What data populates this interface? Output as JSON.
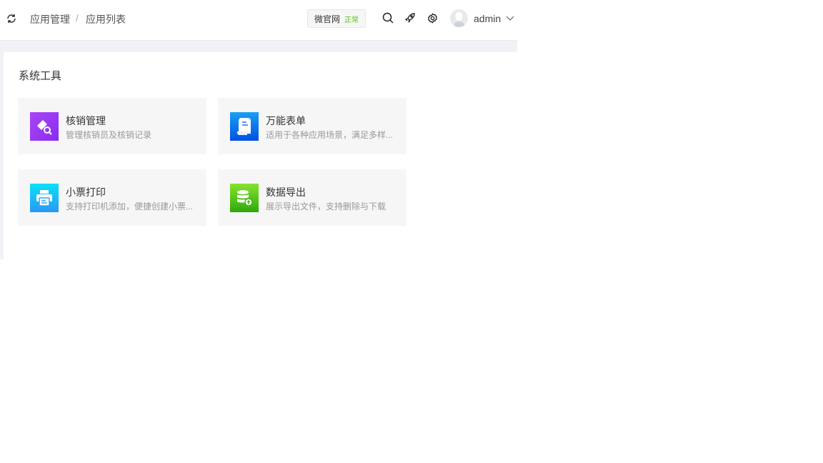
{
  "header": {
    "breadcrumb": [
      "应用管理",
      "应用列表"
    ],
    "separator": "/",
    "site_name": "微官网",
    "site_status": "正常",
    "user": "admin"
  },
  "section_title": "系统工具",
  "apps": [
    {
      "title": "核销管理",
      "desc": "管理核销员及核销记录",
      "color": "#9b3cf7"
    },
    {
      "title": "万能表单",
      "desc": "适用于各种应用场景，满足多样...",
      "color": "#1a73f0"
    },
    {
      "title": "小票打印",
      "desc": "支持打印机添加，便捷创建小票...",
      "color": "#14c6f5"
    },
    {
      "title": "数据导出",
      "desc": "展示导出文件，支持删除与下载",
      "color": "#4cc01e"
    }
  ]
}
